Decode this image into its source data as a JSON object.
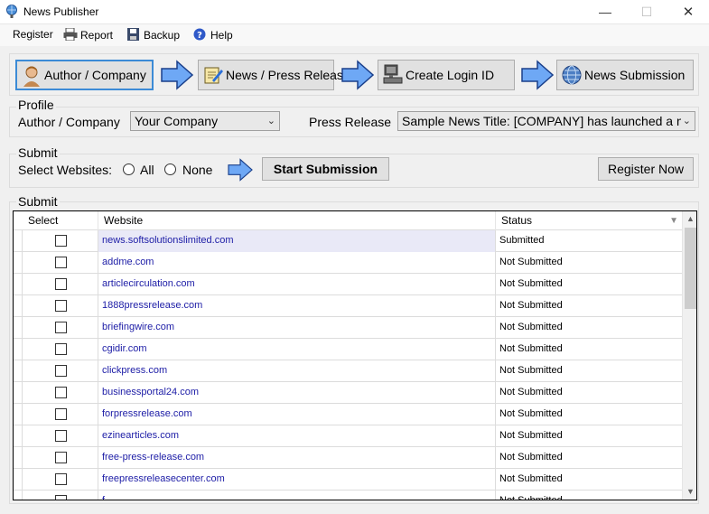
{
  "window": {
    "title": "News Publisher"
  },
  "menu": {
    "register": "Register",
    "report": "Report",
    "backup": "Backup",
    "help": "Help"
  },
  "workflow": {
    "author_company": "Author / Company",
    "news_press_release": "News / Press Release",
    "create_login_id": "Create Login ID",
    "news_submission": "News Submission"
  },
  "profile": {
    "title": "Profile",
    "author_label": "Author / Company",
    "author_value": "Your Company",
    "press_label": "Press Release",
    "press_value": "Sample News Title: [COMPANY] has launched a ne"
  },
  "submit_panel": {
    "title": "Submit",
    "select_websites_label": "Select Websites:",
    "all_label": "All",
    "none_label": "None",
    "start_button": "Start Submission",
    "register_button": "Register Now"
  },
  "grid_panel": {
    "title": "Submit",
    "columns": {
      "select": "Select",
      "website": "Website",
      "status": "Status"
    },
    "rows": [
      {
        "website": "news.softsolutionslimited.com",
        "status": "Submitted"
      },
      {
        "website": "addme.com",
        "status": "Not Submitted"
      },
      {
        "website": "articlecirculation.com",
        "status": "Not Submitted"
      },
      {
        "website": "1888pressrelease.com",
        "status": "Not Submitted"
      },
      {
        "website": "briefingwire.com",
        "status": "Not Submitted"
      },
      {
        "website": "cgidir.com",
        "status": "Not Submitted"
      },
      {
        "website": "clickpress.com",
        "status": "Not Submitted"
      },
      {
        "website": "businessportal24.com",
        "status": "Not Submitted"
      },
      {
        "website": "forpressrelease.com",
        "status": "Not Submitted"
      },
      {
        "website": "ezinearticles.com",
        "status": "Not Submitted"
      },
      {
        "website": "free-press-release.com",
        "status": "Not Submitted"
      },
      {
        "website": "freepressreleasecenter.com",
        "status": "Not Submitted"
      },
      {
        "website": "f...",
        "status": "Not Submitted"
      }
    ]
  },
  "colors": {
    "link": "#1c1ca6",
    "active_border": "#3c8bd6",
    "arrow": "#6ea8f5"
  }
}
